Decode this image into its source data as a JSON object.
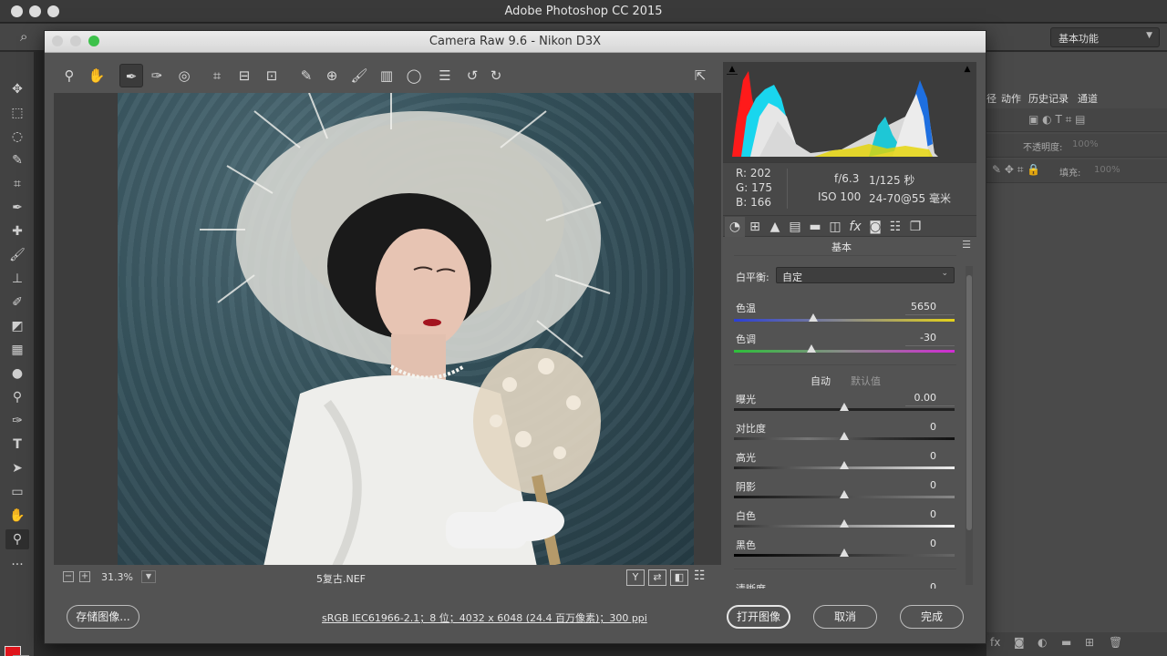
{
  "app": {
    "title": "Adobe Photoshop CC 2015",
    "workspace": "基本功能"
  },
  "ps_panels": {
    "tab_partial": "径",
    "tabs": [
      "动作",
      "历史记录",
      "通道"
    ],
    "opacity_label": "不透明度:",
    "opacity_value": "100%",
    "fill_label": "填充:",
    "fill_value": "100%"
  },
  "dialog": {
    "title": "Camera Raw 9.6 -  Nikon D3X",
    "zoom": "31.3%",
    "file_name": "5复古.NEF",
    "workflow": "sRGB IEC61966-2.1；8 位；4032 x 6048 (24.4 百万像素)；300 ppi",
    "buttons": {
      "save": "存储图像...",
      "open": "打开图像",
      "cancel": "取消",
      "done": "完成"
    },
    "view_buttons": [
      "Y",
      "⇄",
      "◧"
    ]
  },
  "readout": {
    "r": "R:  202",
    "g": "G:  175",
    "b": "B:  166",
    "aperture": "f/6.3",
    "shutter": "1/125 秒",
    "iso": "ISO 100",
    "lens": "24-70@55 毫米"
  },
  "basic_panel": {
    "heading": "基本",
    "wb_label": "白平衡:",
    "wb_value": "自定",
    "temp": {
      "label": "色温",
      "value": "5650",
      "position": 0.36
    },
    "tint": {
      "label": "色调",
      "value": "-30",
      "position": 0.35
    },
    "auto": "自动",
    "default": "默认值",
    "sliders": [
      {
        "label": "曝光",
        "value": "0.00",
        "position": 0.5
      },
      {
        "label": "对比度",
        "value": "0",
        "position": 0.5
      },
      {
        "label": "高光",
        "value": "0",
        "position": 0.5
      },
      {
        "label": "阴影",
        "value": "0",
        "position": 0.5
      },
      {
        "label": "白色",
        "value": "0",
        "position": 0.5
      },
      {
        "label": "黑色",
        "value": "0",
        "position": 0.5
      }
    ],
    "clarity": {
      "label": "清晰度",
      "value": "0"
    }
  },
  "colors": {
    "foreground": "#e0141b",
    "background": "#ffffff",
    "accent_green": "#3cc14a"
  }
}
